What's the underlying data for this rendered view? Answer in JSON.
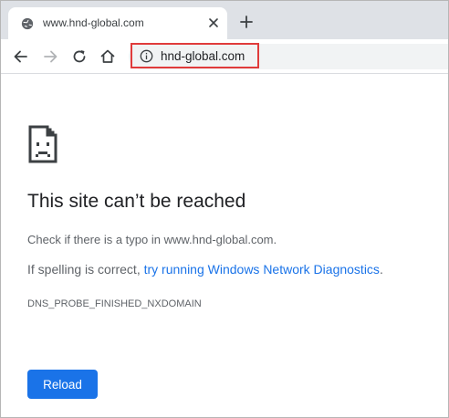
{
  "tab": {
    "title": "www.hnd-global.com",
    "favicon": "globe-icon",
    "close_icon": "close-icon"
  },
  "toolbar": {
    "back_icon": "back-arrow-icon",
    "forward_icon": "forward-arrow-icon",
    "reload_icon": "reload-icon",
    "home_icon": "home-icon",
    "new_tab_icon": "plus-icon"
  },
  "omnibox": {
    "security_icon": "info-icon",
    "url": "hnd-global.com",
    "highlight_color": "#e03b3b"
  },
  "error_page": {
    "icon": "sad-page-icon",
    "heading": "This site can’t be reached",
    "line1": "Check if there is a typo in www.hnd-global.com.",
    "line2_prefix": "If spelling is correct, ",
    "line2_link": "try running Windows Network Diagnostics",
    "line2_suffix": ".",
    "error_code": "DNS_PROBE_FINISHED_NXDOMAIN",
    "reload_label": "Reload"
  },
  "colors": {
    "accent": "#1a73e8",
    "tabstrip_bg": "#dee1e6"
  }
}
